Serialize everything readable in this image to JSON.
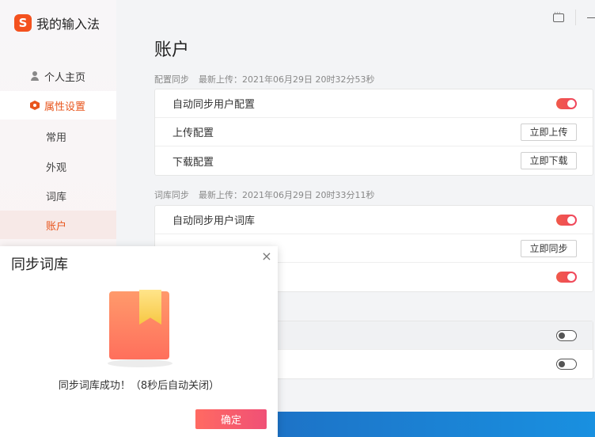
{
  "app": {
    "logo_glyph": "S",
    "name": "我的输入法"
  },
  "sidebar": {
    "items": [
      {
        "label": "个人主页",
        "icon": "person-icon"
      },
      {
        "label": "属性设置",
        "icon": "settings-hex-icon",
        "active": true
      }
    ],
    "subitems": [
      {
        "label": "常用"
      },
      {
        "label": "外观"
      },
      {
        "label": "词库"
      },
      {
        "label": "账户",
        "selected": true
      }
    ]
  },
  "window": {
    "icons": [
      "feedback-icon",
      "minimize-icon"
    ]
  },
  "main": {
    "title": "账户",
    "config_sync": {
      "heading": "配置同步",
      "last_upload": "最新上传：2021年06月29日 20时32分53秒",
      "rows": [
        {
          "label": "自动同步用户配置",
          "toggle": "on"
        },
        {
          "label": "上传配置",
          "button": "立即上传"
        },
        {
          "label": "下载配置",
          "button": "立即下载"
        }
      ]
    },
    "lexicon_sync": {
      "heading": "词库同步",
      "last_upload": "最新上传：2021年06月29日 20时33分11秒",
      "rows": [
        {
          "label": "自动同步用户词库",
          "toggle": "on"
        },
        {
          "label": "",
          "button": "立即同步"
        },
        {
          "label": "",
          "toggle": "on"
        }
      ]
    },
    "other_rows": [
      {
        "label": "",
        "toggle": "off"
      },
      {
        "label": "",
        "toggle": "off"
      }
    ]
  },
  "dialog": {
    "title": "同步词库",
    "close_glyph": "×",
    "message": "同步词库成功！（8秒后自动关闭）",
    "ok_label": "确定"
  },
  "colors": {
    "accent": "#e8551c",
    "toggle_on": "#f0455d",
    "taskbar": "#1a82d4"
  }
}
